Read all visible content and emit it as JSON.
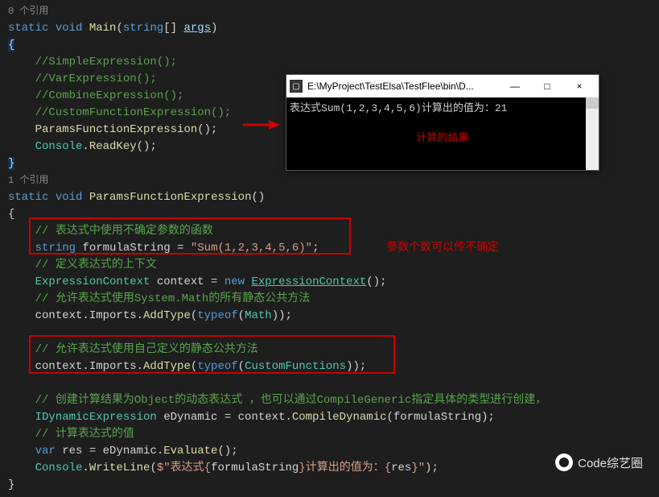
{
  "code": {
    "ref0": "0 个引用",
    "main_sig": {
      "static": "static",
      "void": "void",
      "name": "Main",
      "paren_open": "(",
      "string_arr": "string",
      "brackets": "[] ",
      "args": "args",
      "paren_close": ")"
    },
    "brace_open": "{",
    "brace_close": "}",
    "c_simple": "//SimpleExpression();",
    "c_var": "//VarExpression();",
    "c_combine": "//CombineExpression();",
    "c_custom": "//CustomFunctionExpression();",
    "call_params": {
      "name": "ParamsFunctionExpression",
      "tail": "();"
    },
    "call_console": {
      "cls": "Console",
      "dot": ".",
      "method": "ReadKey",
      "tail": "();"
    },
    "ref1": "1 个引用",
    "pfe_sig": {
      "static": "static",
      "void": "void",
      "name": "ParamsFunctionExpression",
      "tail": "()"
    },
    "c_formula": "// 表达式中使用不确定参数的函数",
    "formula_line": {
      "type": "string",
      "var": " formulaString = ",
      "val": "\"Sum(1,2,3,4,5,6)\"",
      "semi": ";"
    },
    "c_context": "// 定义表达式的上下文",
    "ctx_line": {
      "type": "ExpressionContext",
      "var": " context = ",
      "new": "new",
      "ctor": "ExpressionContext",
      "tail": "();"
    },
    "c_math": "// 允许表达式使用System.Math的所有静态公共方法",
    "math_line": {
      "pre": "context.Imports.",
      "method": "AddType",
      "open": "(",
      "typeof": "typeof",
      "open2": "(",
      "cls": "Math",
      "close": "));"
    },
    "c_custom2": "// 允许表达式使用自己定义的静态公共方法",
    "custom_line": {
      "pre": "context.Imports.",
      "method": "AddType",
      "open": "(",
      "typeof": "typeof",
      "open2": "(",
      "cls": "CustomFunctions",
      "close": "));"
    },
    "c_dynamic": "// 创建计算结果为Object的动态表达式 ，也可以通过CompileGeneric指定具体的类型进行创建，",
    "dyn_line": {
      "type": "IDynamicExpression",
      "var": " eDynamic = context.",
      "method": "CompileDynamic",
      "tail": "(formulaString);"
    },
    "c_eval": "// 计算表达式的值",
    "eval_line": {
      "var_kw": "var",
      "rest": " res = eDynamic.",
      "method": "Evaluate",
      "tail": "();"
    },
    "write_line": {
      "cls": "Console",
      "dot": ".",
      "method": "WriteLine",
      "open": "(",
      "dollar": "$",
      "str1": "\"表达式{",
      "interp1": "formulaString",
      "str2": "}计算出的值为：{",
      "interp2": "res",
      "str3": "}\"",
      "close": ");"
    }
  },
  "console": {
    "title": "E:\\MyProject\\TestElsa\\TestFlee\\bin\\D...",
    "output": "表达式Sum(1,2,3,4,5,6)计算出的值为：21",
    "result_label": "计算的结果",
    "min": "—",
    "max": "□",
    "close": "×"
  },
  "annotations": {
    "param_note": "参数个数可以传不确定"
  },
  "watermark": "Code综艺圈"
}
